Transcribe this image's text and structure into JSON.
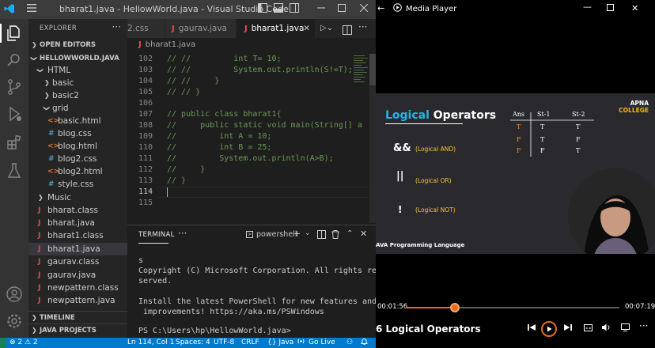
{
  "vscode": {
    "title": "bharat1.java - HellowWorld.java - Visual Studio Code",
    "explorer": {
      "header": "EXPLORER",
      "open_editors": "OPEN EDITORS",
      "workspace": "HELLOWWORLD.JAVA",
      "items": [
        {
          "label": "HTML",
          "kind": "folder-open"
        },
        {
          "label": "basic",
          "kind": "folder"
        },
        {
          "label": "basic2",
          "kind": "folder"
        },
        {
          "label": "grid",
          "kind": "folder-open"
        },
        {
          "label": "basic.html",
          "kind": "html"
        },
        {
          "label": "blog.css",
          "kind": "css"
        },
        {
          "label": "blog.html",
          "kind": "html"
        },
        {
          "label": "blog2.css",
          "kind": "css"
        },
        {
          "label": "blog2.html",
          "kind": "html"
        },
        {
          "label": "style.css",
          "kind": "css"
        },
        {
          "label": "Music",
          "kind": "folder"
        },
        {
          "label": "bharat.class",
          "kind": "java"
        },
        {
          "label": "bharat.java",
          "kind": "java"
        },
        {
          "label": "bharat1.class",
          "kind": "java"
        },
        {
          "label": "bharat1.java",
          "kind": "java"
        },
        {
          "label": "gaurav.class",
          "kind": "java"
        },
        {
          "label": "gaurav.java",
          "kind": "java"
        },
        {
          "label": "newpattern.class",
          "kind": "java"
        },
        {
          "label": "newpattern.java",
          "kind": "java"
        }
      ],
      "timeline": "TIMELINE",
      "java_projects": "JAVA PROJECTS"
    },
    "tabs": [
      {
        "label": "2.css"
      },
      {
        "label": "gaurav.java"
      },
      {
        "label": "bharat1.java"
      }
    ],
    "breadcrumb": "bharat1.java",
    "code_lines": [
      {
        "n": "102",
        "text": "// //         int T= 10;"
      },
      {
        "n": "103",
        "text": "// //         System.out.println(S!=T);"
      },
      {
        "n": "104",
        "text": "// //     }"
      },
      {
        "n": "105",
        "text": "// // }"
      },
      {
        "n": "106",
        "text": ""
      },
      {
        "n": "107",
        "text": "// public class bharat1{"
      },
      {
        "n": "108",
        "text": "//     public static void main(String[] a"
      },
      {
        "n": "109",
        "text": "//         int A = 10;"
      },
      {
        "n": "110",
        "text": "//         int B = 25;"
      },
      {
        "n": "111",
        "text": "//         System.out.println(A>B);"
      },
      {
        "n": "112",
        "text": "//     }"
      },
      {
        "n": "113",
        "text": "// }"
      },
      {
        "n": "114",
        "text": ""
      },
      {
        "n": "115",
        "text": ""
      }
    ],
    "panel": {
      "tab": "TERMINAL",
      "shell": "powershell",
      "lines": [
        "s",
        "Copyright (C) Microsoft Corporation. All rights re",
        "served.",
        "",
        "Install the latest PowerShell for new features and",
        " improvements! https://aka.ms/PSWindows",
        "",
        "PS C:\\Users\\hp\\HellowWorld.java>"
      ]
    },
    "status": {
      "problems": "⊗ 2 ⚠ 2",
      "position": "Ln 114, Col 1",
      "spaces": "Spaces: 4",
      "encoding": "UTF-8",
      "eol": "CRLF",
      "language": "{} Java",
      "golive": "Go Live"
    }
  },
  "media": {
    "title": "Media Player",
    "slide": {
      "title_blue": "Logical",
      "title_rest": " Operators",
      "brand_1": "APNA",
      "brand_2": "COLLEGE",
      "ops": [
        {
          "sym": "&&",
          "name": "(Logical AND)"
        },
        {
          "sym": "||",
          "name": "(Logical OR)"
        },
        {
          "sym": "!",
          "name": "(Logical NOT)"
        }
      ],
      "table_head": [
        "Ans",
        "St-1",
        "St-2"
      ],
      "table_rows": [
        [
          "T",
          "T",
          "T"
        ],
        [
          "F",
          "T",
          "F"
        ],
        [
          "F",
          "F",
          "T"
        ]
      ],
      "footer": "AVA Programming Language"
    },
    "elapsed": "00:01:56",
    "total": "00:07:19",
    "progress": 0.23,
    "now_playing": "6 Logical Operators"
  }
}
